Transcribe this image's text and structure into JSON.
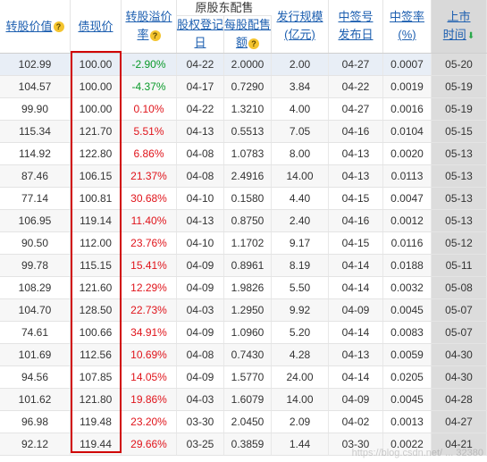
{
  "header": {
    "group_title": "原股东配售",
    "columns": [
      {
        "key": "stock_price",
        "lines": [
          "转股价值"
        ],
        "help_icon": "question-icon"
      },
      {
        "key": "bond_price",
        "lines": [
          "债现价"
        ]
      },
      {
        "key": "premium",
        "lines": [
          "转股溢价",
          "率"
        ],
        "help_icon": "question-icon"
      },
      {
        "key": "record_date",
        "lines": [
          "股权登记",
          "日"
        ]
      },
      {
        "key": "per_share",
        "lines": [
          "每股配售",
          "额"
        ],
        "help_icon": "question-icon"
      },
      {
        "key": "issue_size",
        "lines": [
          "发行规模",
          "(亿元)"
        ]
      },
      {
        "key": "lottery_date",
        "lines": [
          "中签号",
          "发布日"
        ]
      },
      {
        "key": "lottery_rate",
        "lines": [
          "中签率",
          "(%)"
        ]
      },
      {
        "key": "listing_date",
        "lines": [
          "上市",
          "时间"
        ],
        "sort_icon": "sort-down-arrow-icon"
      }
    ]
  },
  "rows": [
    [
      "102.99",
      "100.00",
      "-2.90%",
      "04-22",
      "2.0000",
      "2.00",
      "04-27",
      "0.0007",
      "05-20"
    ],
    [
      "104.57",
      "100.00",
      "-4.37%",
      "04-17",
      "0.7290",
      "3.84",
      "04-22",
      "0.0019",
      "05-19"
    ],
    [
      "99.90",
      "100.00",
      "0.10%",
      "04-22",
      "1.3210",
      "4.00",
      "04-27",
      "0.0016",
      "05-19"
    ],
    [
      "115.34",
      "121.70",
      "5.51%",
      "04-13",
      "0.5513",
      "7.05",
      "04-16",
      "0.0104",
      "05-15"
    ],
    [
      "114.92",
      "122.80",
      "6.86%",
      "04-08",
      "1.0783",
      "8.00",
      "04-13",
      "0.0020",
      "05-13"
    ],
    [
      "87.46",
      "106.15",
      "21.37%",
      "04-08",
      "2.4916",
      "14.00",
      "04-13",
      "0.0113",
      "05-13"
    ],
    [
      "77.14",
      "100.81",
      "30.68%",
      "04-10",
      "0.1580",
      "4.40",
      "04-15",
      "0.0047",
      "05-13"
    ],
    [
      "106.95",
      "119.14",
      "11.40%",
      "04-13",
      "0.8750",
      "2.40",
      "04-16",
      "0.0012",
      "05-13"
    ],
    [
      "90.50",
      "112.00",
      "23.76%",
      "04-10",
      "1.1702",
      "9.17",
      "04-15",
      "0.0116",
      "05-12"
    ],
    [
      "99.78",
      "115.15",
      "15.41%",
      "04-09",
      "0.8961",
      "8.19",
      "04-14",
      "0.0188",
      "05-11"
    ],
    [
      "108.29",
      "121.60",
      "12.29%",
      "04-09",
      "1.9826",
      "5.50",
      "04-14",
      "0.0032",
      "05-08"
    ],
    [
      "104.70",
      "128.50",
      "22.73%",
      "04-03",
      "1.2950",
      "9.92",
      "04-09",
      "0.0045",
      "05-07"
    ],
    [
      "74.61",
      "100.66",
      "34.91%",
      "04-09",
      "1.0960",
      "5.20",
      "04-14",
      "0.0083",
      "05-07"
    ],
    [
      "101.69",
      "112.56",
      "10.69%",
      "04-08",
      "0.7430",
      "4.28",
      "04-13",
      "0.0059",
      "04-30"
    ],
    [
      "94.56",
      "107.85",
      "14.05%",
      "04-09",
      "1.5770",
      "24.00",
      "04-14",
      "0.0205",
      "04-30"
    ],
    [
      "101.62",
      "121.80",
      "19.86%",
      "04-03",
      "1.6079",
      "14.00",
      "04-09",
      "0.0045",
      "04-28"
    ],
    [
      "96.98",
      "119.48",
      "23.20%",
      "03-30",
      "2.0450",
      "2.09",
      "04-02",
      "0.0013",
      "04-27"
    ],
    [
      "92.12",
      "119.44",
      "29.66%",
      "03-25",
      "0.3859",
      "1.44",
      "03-30",
      "0.0022",
      "04-21"
    ]
  ],
  "watermark": "https://blog.csdn.net/ ... 32380",
  "colors": {
    "header_link": "#1d5fb0",
    "positive_premium": "#e0141b",
    "negative_premium": "#0a9a2a",
    "highlight_box": "#d00000"
  }
}
